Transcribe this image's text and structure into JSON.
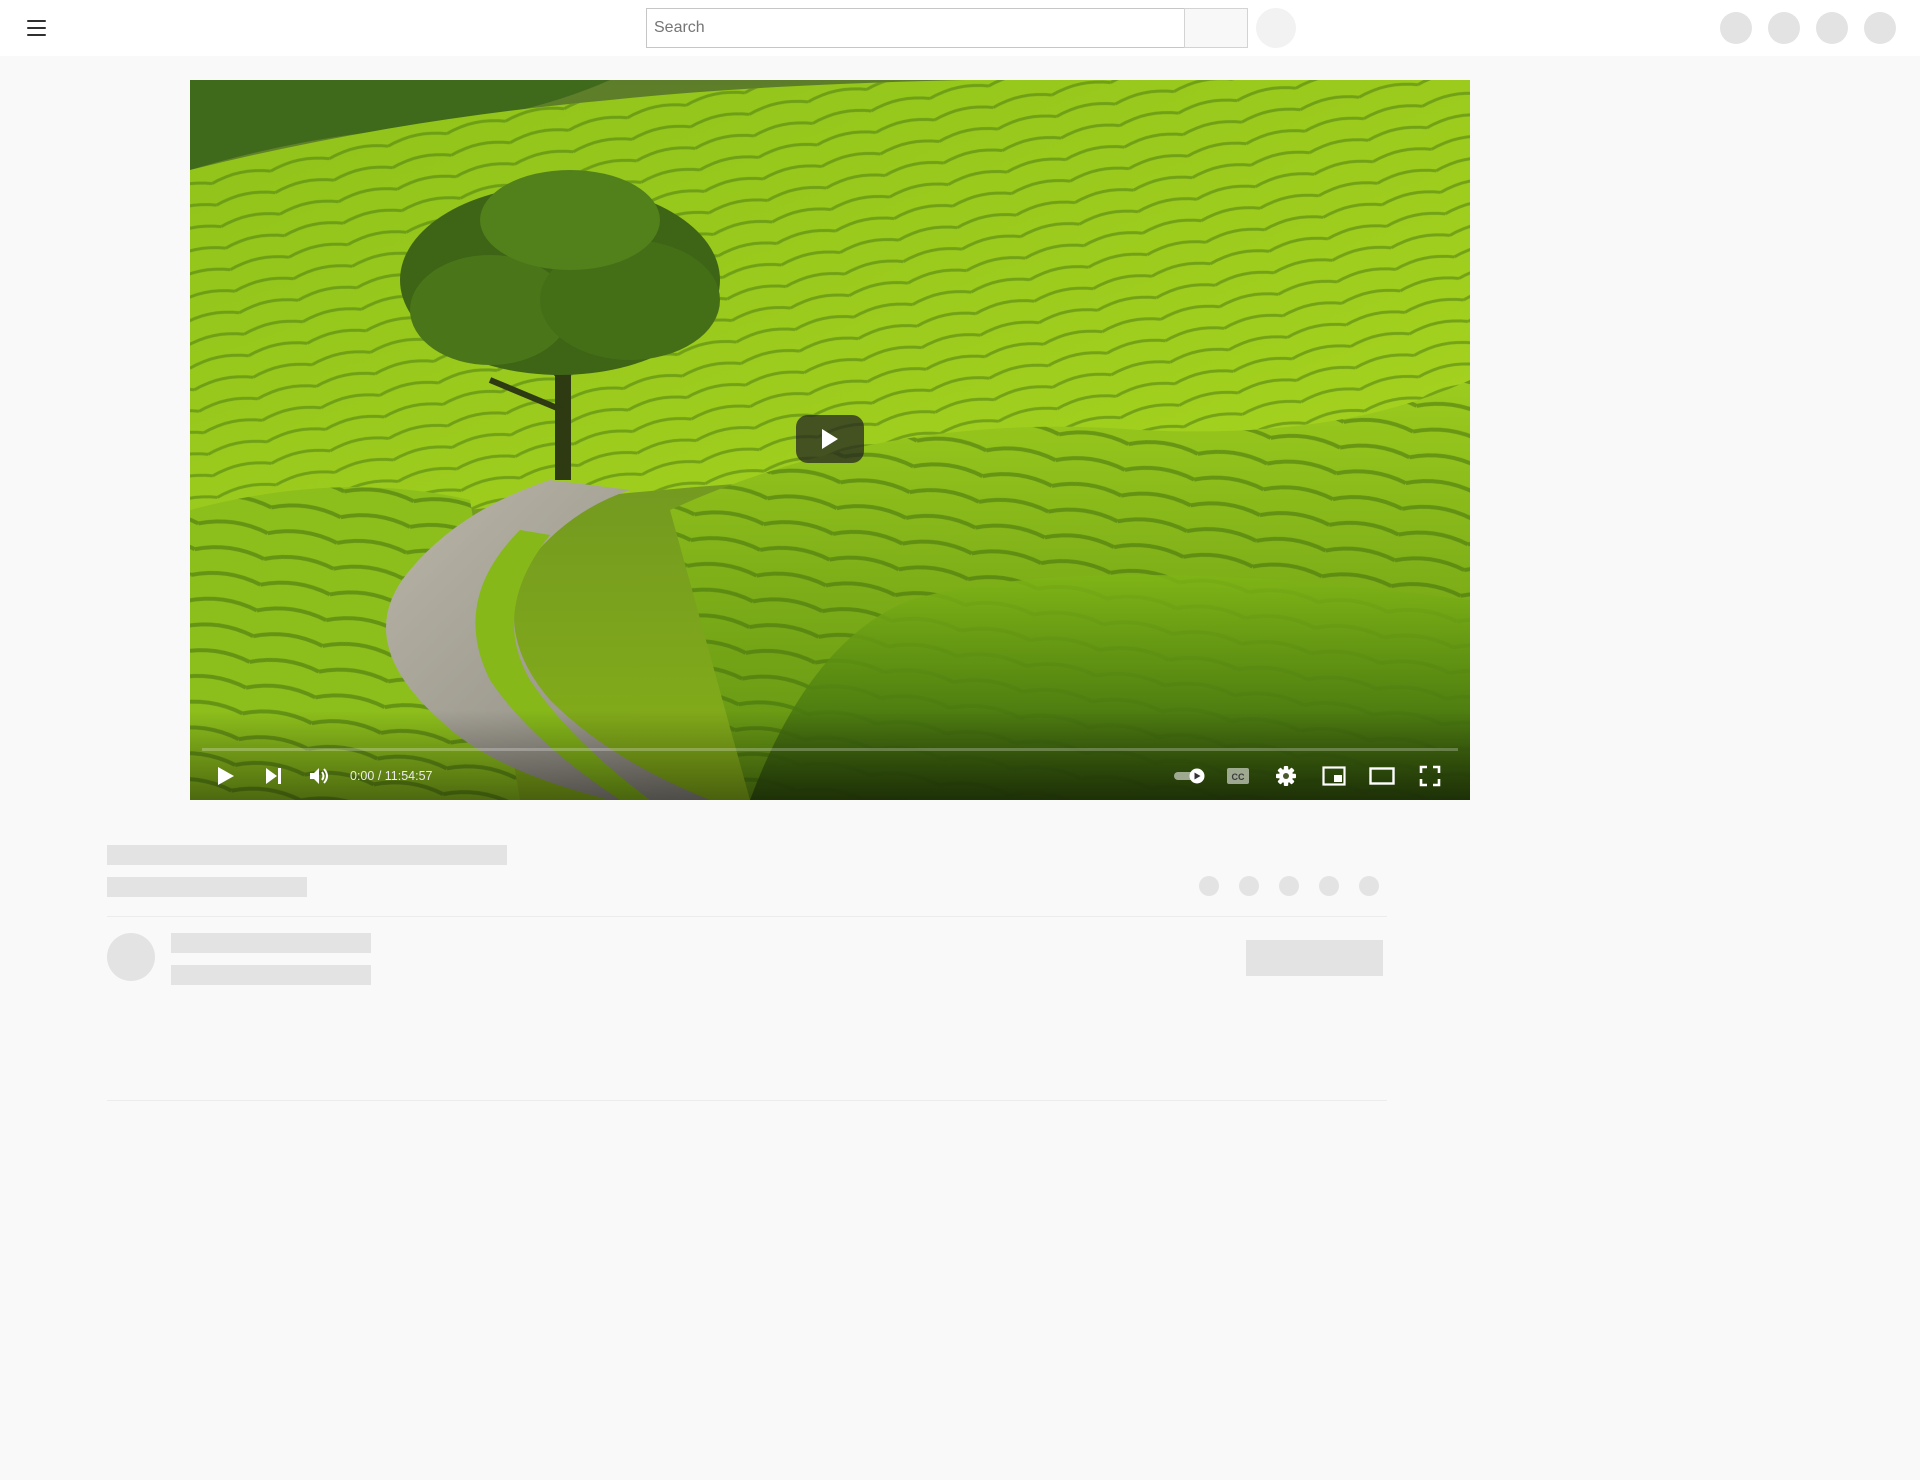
{
  "masthead": {
    "menu_icon": "hamburger-menu-icon",
    "search": {
      "placeholder": "Search",
      "value": ""
    }
  },
  "player": {
    "thumbnail_description": "scenic",
    "time": {
      "current": "0:00",
      "separator": " / ",
      "duration": "11:54:57",
      "display": "0:00 / 11:54:57"
    },
    "progress": 0,
    "autoplay": true,
    "controls": {
      "left": [
        "play-icon",
        "next-icon",
        "volume-icon"
      ],
      "right": [
        "autoplay-toggle-icon",
        "captions-icon",
        "settings-icon",
        "miniplayer-icon",
        "theater-mode-icon",
        "fullscreen-icon"
      ]
    }
  },
  "colors": {
    "page_background": "#f9f9f9",
    "masthead_background": "#ffffff",
    "skeleton": "#e3e3e3",
    "player_controls": "#ffffff"
  }
}
